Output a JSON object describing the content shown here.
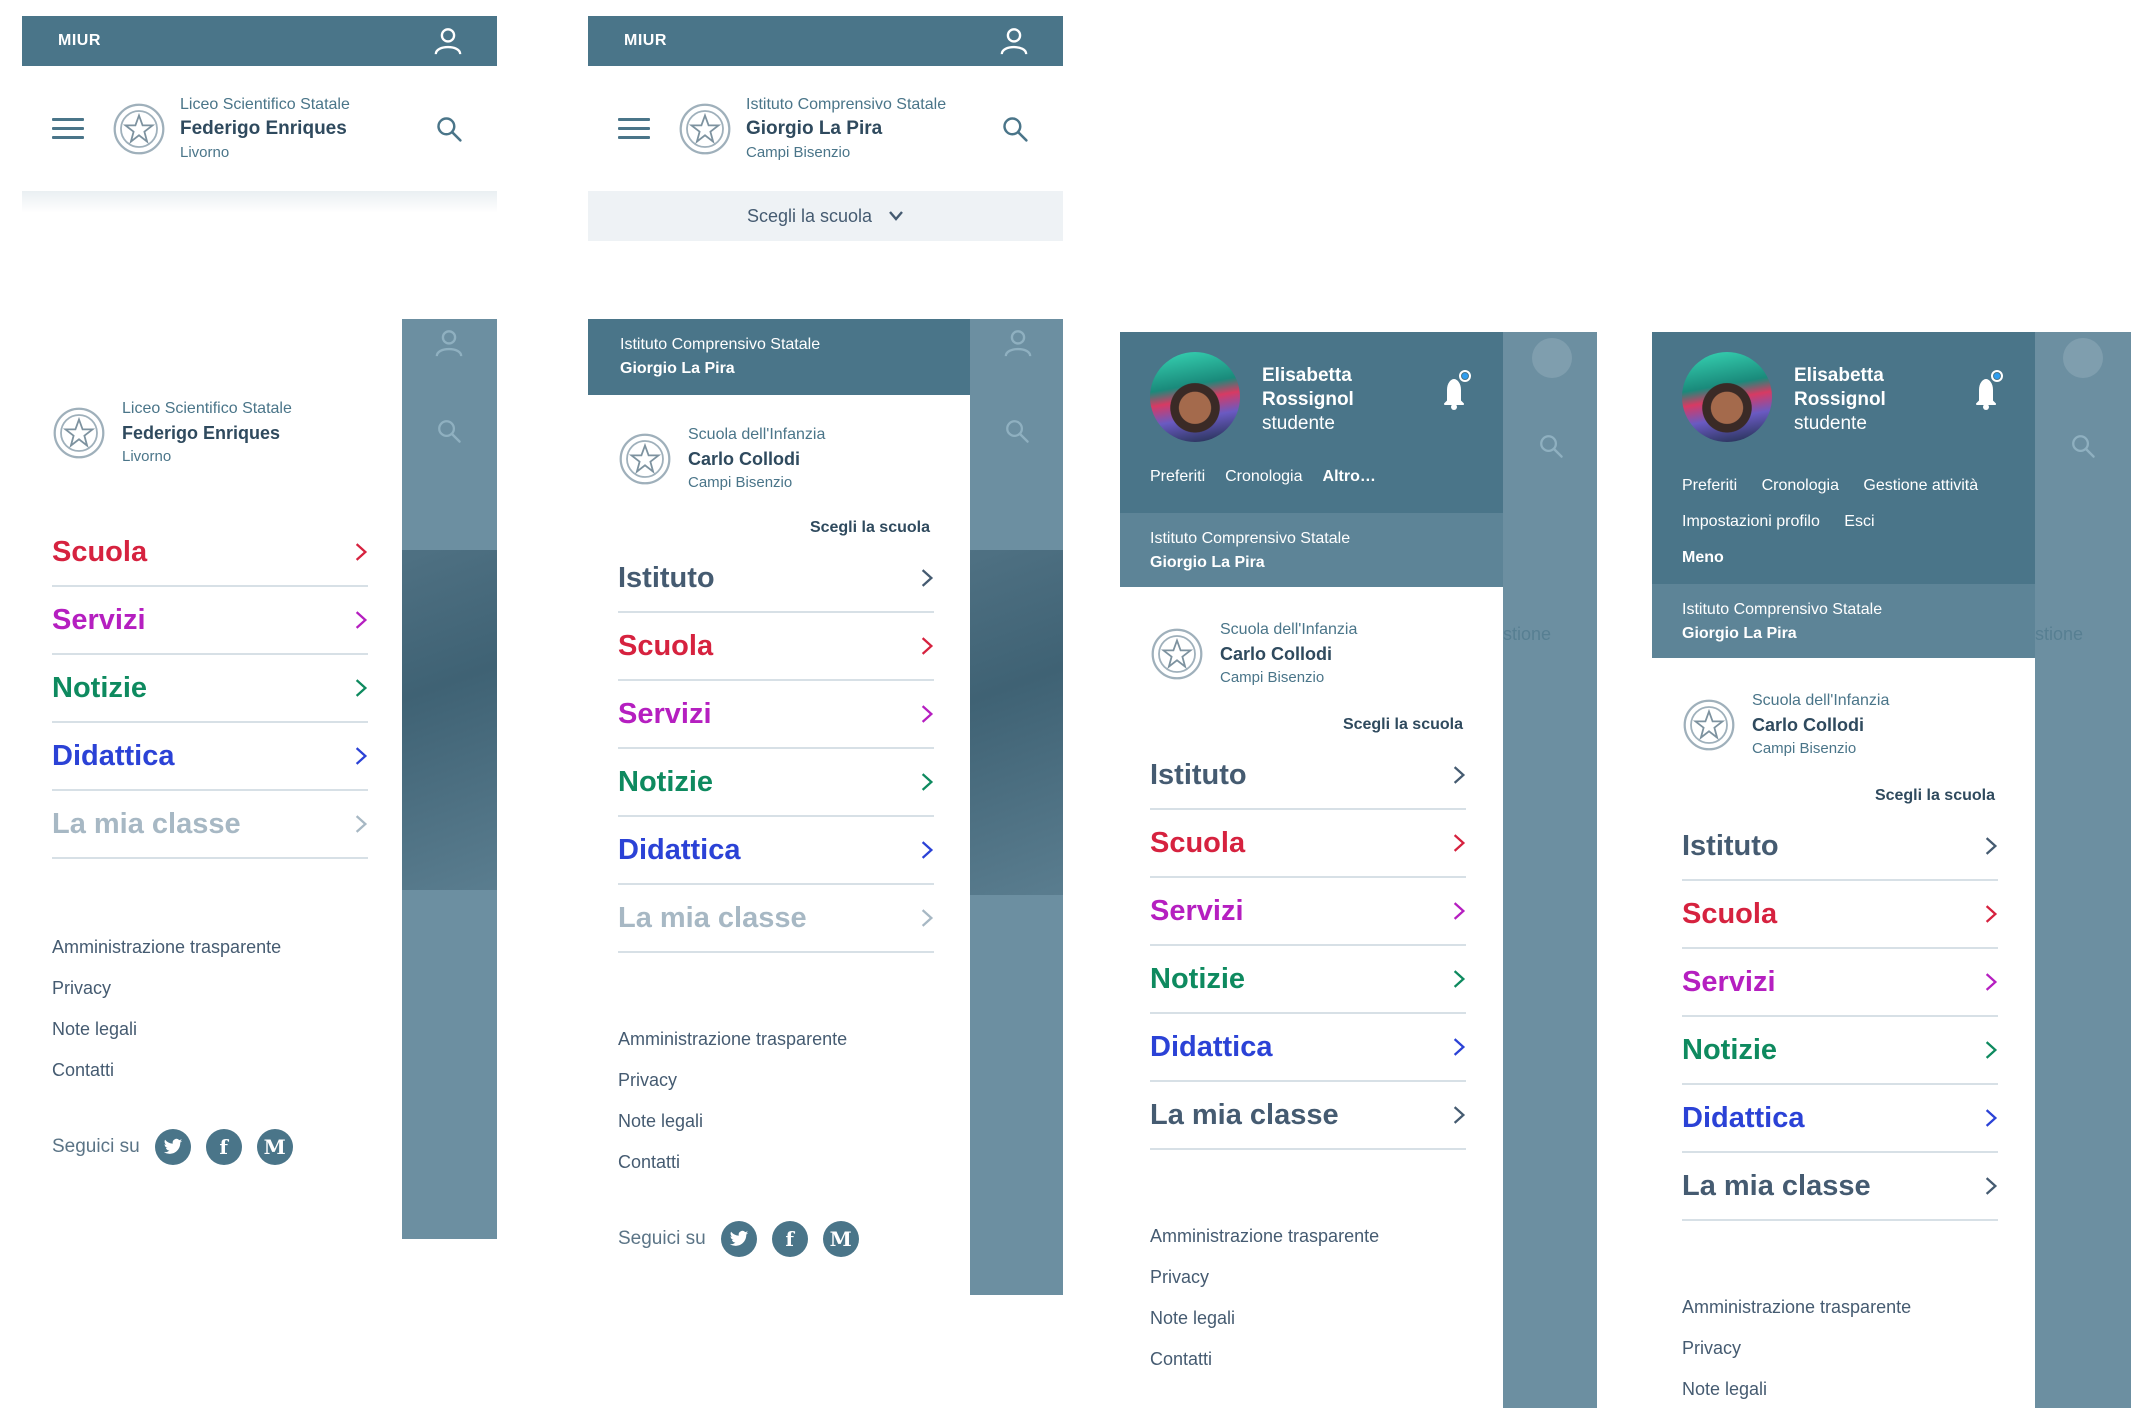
{
  "miur": "MIUR",
  "panel1": {
    "brand": {
      "type": "Liceo Scientifico Statale",
      "name": "Federigo Enriques",
      "city": "Livorno"
    }
  },
  "panel2": {
    "brand": {
      "type": "Istituto Comprensivo Statale",
      "name": "Giorgio La Pira",
      "city": "Campi Bisenzio"
    },
    "choose_school": "Scegli la scuola"
  },
  "menu1": {
    "brand": {
      "type": "Liceo Scientifico Statale",
      "name": "Federigo Enriques",
      "city": "Livorno"
    },
    "items": [
      "Scuola",
      "Servizi",
      "Notizie",
      "Didattica",
      "La mia classe"
    ]
  },
  "menu2": {
    "strip": {
      "type": "Istituto Comprensivo Statale",
      "name": "Giorgio La Pira"
    },
    "brand": {
      "type": "Scuola dell'Infanzia",
      "name": "Carlo Collodi",
      "city": "Campi Bisenzio"
    },
    "choose_school": "Scegli la scuola",
    "items": [
      "Istituto",
      "Scuola",
      "Servizi",
      "Notizie",
      "Didattica",
      "La mia classe"
    ]
  },
  "menu3": {
    "user": {
      "first": "Elisabetta",
      "last": "Rossignol",
      "role": "studente"
    },
    "quick_links": [
      "Preferiti",
      "Cronologia",
      "Altro…"
    ],
    "strip": {
      "type": "Istituto Comprensivo Statale",
      "name": "Giorgio La Pira"
    },
    "brand": {
      "type": "Scuola dell'Infanzia",
      "name": "Carlo Collodi",
      "city": "Campi Bisenzio"
    },
    "choose_school": "Scegli la scuola",
    "items": [
      "Istituto",
      "Scuola",
      "Servizi",
      "Notizie",
      "Didattica",
      "La mia classe"
    ],
    "ghost": "stione"
  },
  "menu4": {
    "user": {
      "first": "Elisabetta",
      "last": "Rossignol",
      "role": "studente"
    },
    "quick_links": [
      "Preferiti",
      "Cronologia",
      "Gestione attività",
      "Impostazioni profilo",
      "Esci",
      "Meno"
    ],
    "strip": {
      "type": "Istituto Comprensivo Statale",
      "name": "Giorgio La Pira"
    },
    "brand": {
      "type": "Scuola dell'Infanzia",
      "name": "Carlo Collodi",
      "city": "Campi Bisenzio"
    },
    "choose_school": "Scegli la scuola",
    "items": [
      "Istituto",
      "Scuola",
      "Servizi",
      "Notizie",
      "Didattica",
      "La mia classe"
    ],
    "ghost": "stione"
  },
  "footer": {
    "links": [
      "Amministrazione trasparente",
      "Privacy",
      "Note legali",
      "Contatti"
    ],
    "follow": "Seguici su",
    "social_icons": [
      "twitter-icon",
      "facebook-icon",
      "medium-icon"
    ]
  },
  "colors": {
    "primary": "#4a7589",
    "scuola": "#d6223f",
    "servizi": "#b51fc0",
    "notizie": "#0e8a5f",
    "didattica": "#2b42d6",
    "muted": "#a7b8c4"
  }
}
